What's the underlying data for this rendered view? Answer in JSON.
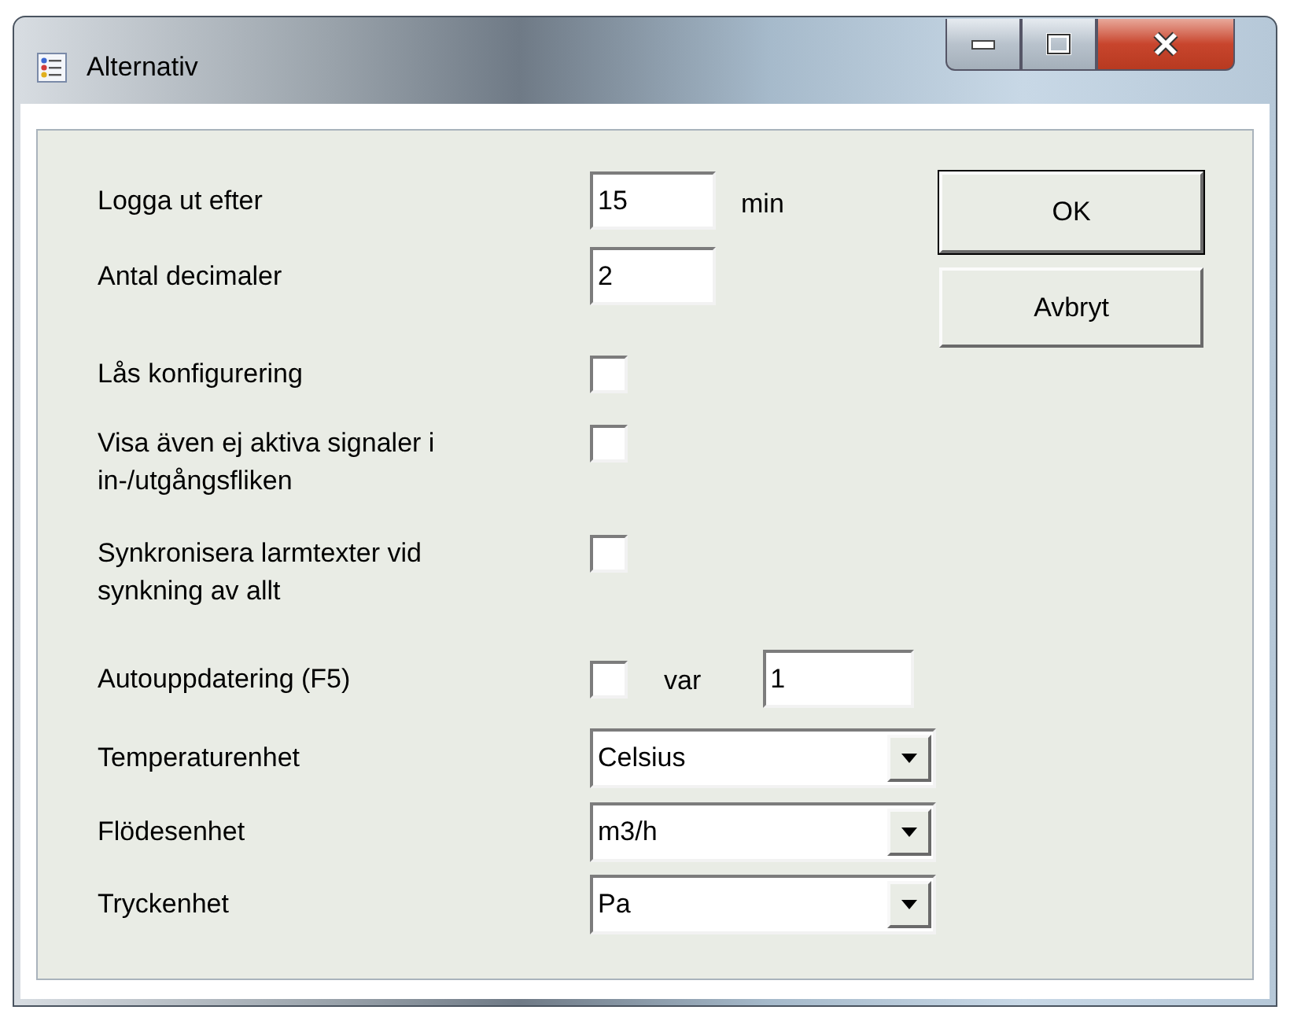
{
  "window": {
    "title": "Alternativ"
  },
  "options": [
    {
      "kind": "text",
      "label": "Logga ut efter",
      "value": "15",
      "unit": "min"
    },
    {
      "kind": "text",
      "label": "Antal decimaler",
      "value": "2"
    },
    {
      "kind": "checkbox",
      "label": "Lås konfigurering",
      "checked": false
    },
    {
      "kind": "checkbox",
      "label": "Visa även ej aktiva signaler i in-/utgångsfliken",
      "checked": false
    },
    {
      "kind": "checkbox",
      "label": "Synkronisera larmtexter vid synkning av allt",
      "checked": false
    },
    {
      "kind": "checkbox_text",
      "label": "Autouppdatering (F5)",
      "checked": false,
      "unit": "var",
      "value": "1"
    },
    {
      "kind": "combo",
      "label": "Temperaturenhet",
      "value": "Celsius"
    },
    {
      "kind": "combo",
      "label": "Flödesenhet",
      "value": "m3/h"
    },
    {
      "kind": "combo",
      "label": "Tryckenhet",
      "value": "Pa"
    }
  ],
  "buttons": [
    {
      "label": "OK",
      "default": true
    },
    {
      "label": "Avbryt",
      "default": false
    }
  ]
}
